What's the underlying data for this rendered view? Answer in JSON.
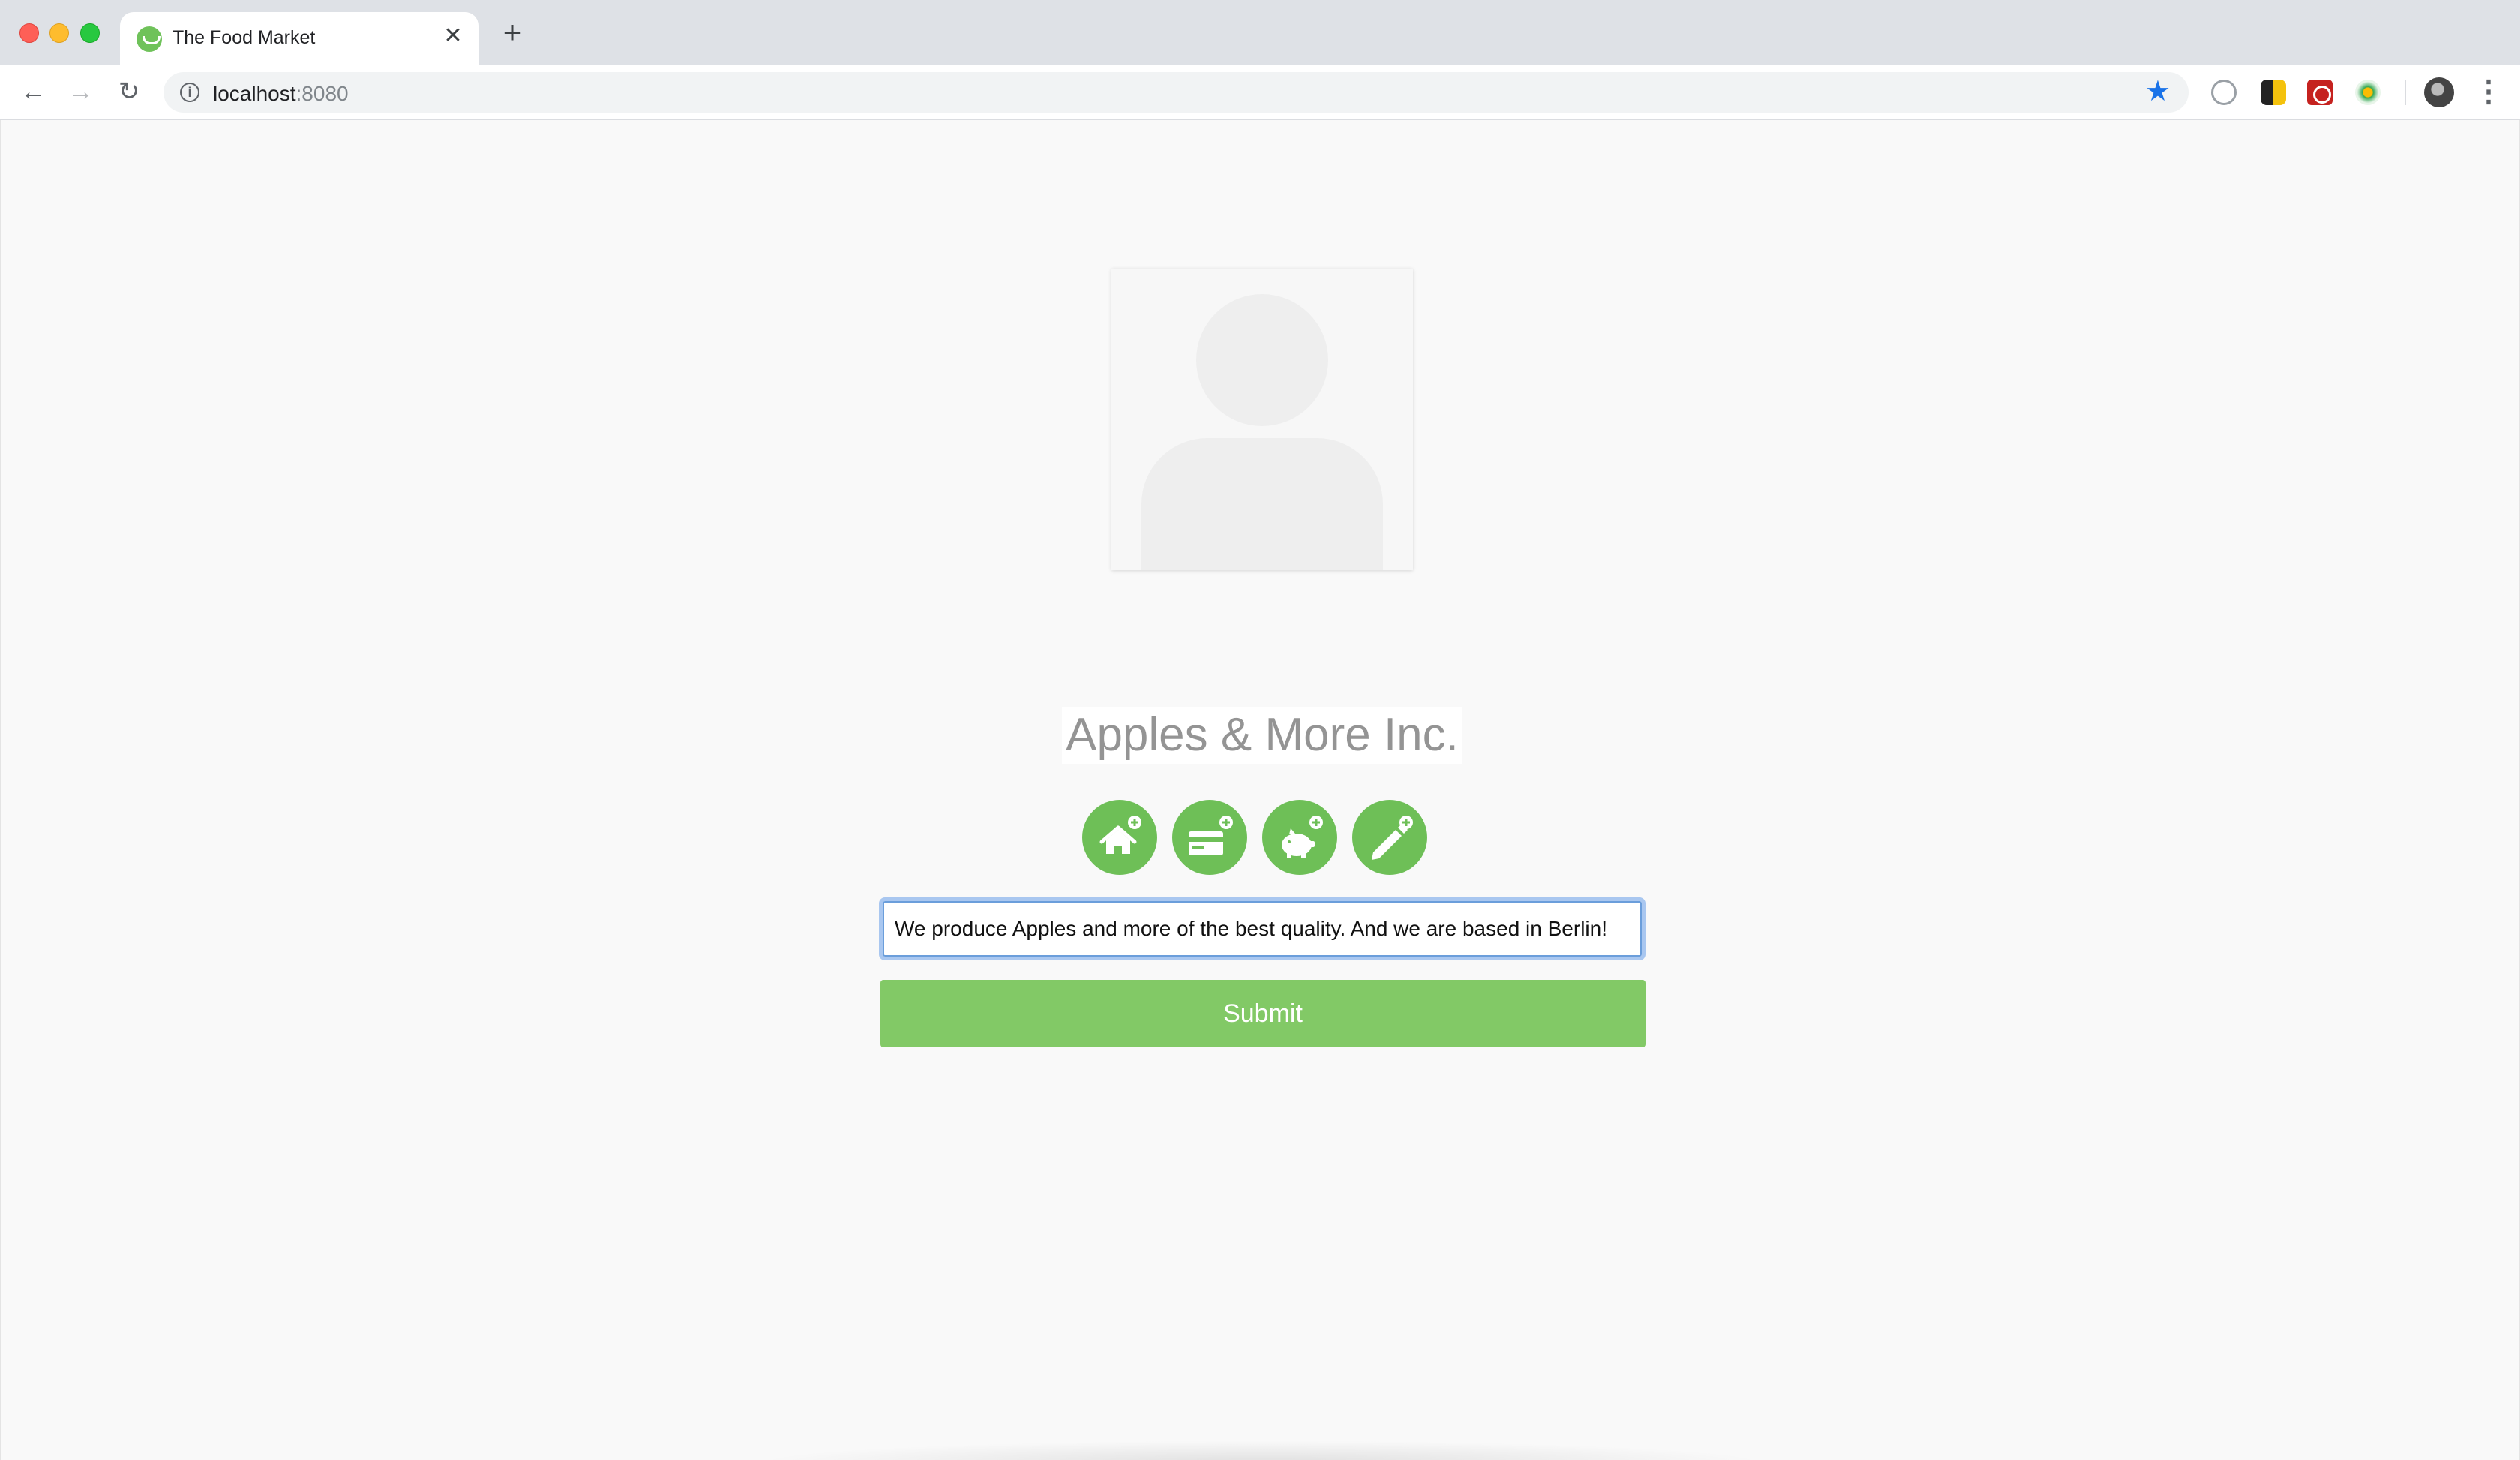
{
  "browser": {
    "tab": {
      "title": "The Food Market",
      "favicon": "food-market-logo-icon",
      "close_icon": "✕"
    },
    "new_tab_icon": "+",
    "nav": {
      "back_icon": "←",
      "forward_icon": "→",
      "reload_icon": "↻"
    },
    "address": {
      "host": "localhost",
      "port": ":8080",
      "info_icon": "i",
      "star_icon": "★"
    },
    "menu_icon": "⋮"
  },
  "profile": {
    "image": "placeholder-avatar",
    "company_name": "Apples & More Inc.",
    "actions": [
      {
        "name": "add-address",
        "icon": "home-plus-icon"
      },
      {
        "name": "add-payment",
        "icon": "credit-card-plus-icon"
      },
      {
        "name": "add-savings",
        "icon": "piggy-bank-plus-icon"
      },
      {
        "name": "add-description",
        "icon": "pencil-plus-icon"
      }
    ],
    "description_value": "We produce Apples and more of the best quality. And we are based in Berlin!",
    "submit_label": "Submit"
  },
  "colors": {
    "accent_green": "#6ebf57",
    "submit_green": "#82c966",
    "focus_blue": "#6b9edb",
    "name_gray": "#949494"
  }
}
